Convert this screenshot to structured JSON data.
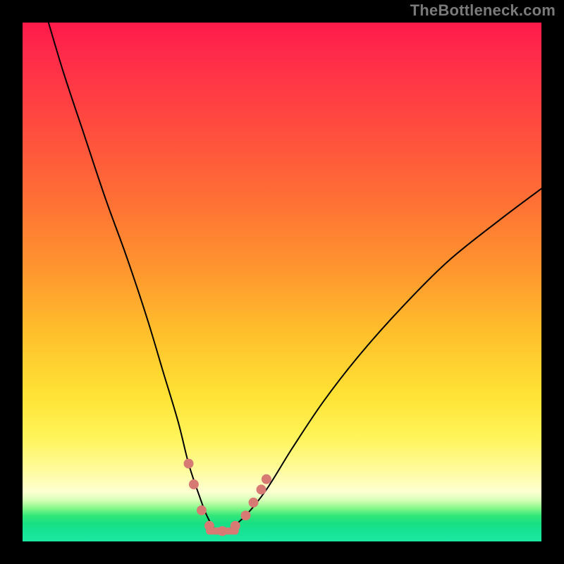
{
  "watermark": "TheBottleneck.com",
  "colors": {
    "frame": "#000000",
    "watermark": "#7a7a7a",
    "curve": "#000000",
    "marker": "#d87a74",
    "gradient_stops": [
      "#ff1a4a",
      "#ff2a4a",
      "#ff4640",
      "#ff6f35",
      "#ff972e",
      "#ffc02c",
      "#ffe335",
      "#fff45a",
      "#fffb9a",
      "#fdffd2",
      "#d8ffb8",
      "#8cf98c",
      "#33e77a",
      "#18df82",
      "#17e394",
      "#1be7a2"
    ]
  },
  "chart_data": {
    "type": "line",
    "title": "",
    "xlabel": "",
    "ylabel": "",
    "xlim": [
      0,
      100
    ],
    "ylim": [
      0,
      100
    ],
    "series": [
      {
        "name": "bottleneck-curve",
        "x": [
          5,
          8,
          12,
          16,
          20,
          24,
          27,
          30,
          32,
          34,
          35.5,
          37,
          38.5,
          40,
          43,
          47,
          52,
          58,
          65,
          73,
          82,
          92,
          100
        ],
        "y": [
          100,
          90,
          78,
          66,
          55,
          43,
          33,
          23,
          15,
          9,
          5,
          2.5,
          2,
          2.5,
          5,
          10,
          18,
          27,
          36,
          45,
          54,
          62,
          68
        ]
      }
    ],
    "markers": {
      "name": "highlight-cluster",
      "points": [
        {
          "x": 32.0,
          "y": 15
        },
        {
          "x": 33.0,
          "y": 11
        },
        {
          "x": 34.5,
          "y": 6
        },
        {
          "x": 36.0,
          "y": 3
        },
        {
          "x": 38.5,
          "y": 2
        },
        {
          "x": 41.0,
          "y": 3
        },
        {
          "x": 43.0,
          "y": 5
        },
        {
          "x": 44.5,
          "y": 7.5
        },
        {
          "x": 46.0,
          "y": 10
        },
        {
          "x": 47.0,
          "y": 12
        }
      ],
      "flat_segment": {
        "x_start": 36.0,
        "x_end": 41.0,
        "y": 2
      }
    },
    "background": {
      "description": "Vertical heat gradient. Top (y≈100) is hot (red), transitions through orange/yellow, thin green band near y≈5, bright green at y=0.",
      "stops_y": [
        100,
        94,
        82,
        66,
        52,
        40,
        28,
        20,
        14,
        9.5,
        8,
        6.5,
        5,
        3.5,
        2,
        0
      ]
    }
  }
}
